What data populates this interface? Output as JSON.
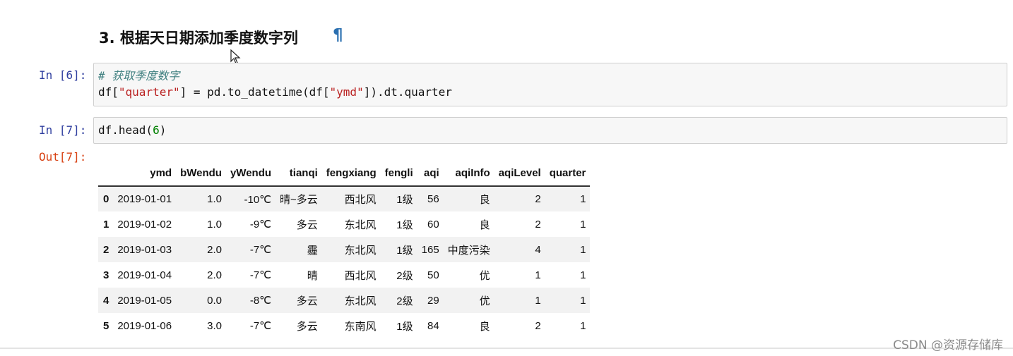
{
  "heading": "3. 根据天日期添加季度数字列",
  "pilcrow": "¶",
  "cells": {
    "in6": {
      "prompt": "In [6]:",
      "comment": "# 获取季度数字",
      "code_a": "df[",
      "code_s1": "\"quarter\"",
      "code_b": "] = pd.to_datetime(df[",
      "code_s2": "\"ymd\"",
      "code_c": "]).dt.quarter"
    },
    "in7": {
      "prompt": "In [7]:",
      "code_a": "df.head(",
      "code_num": "6",
      "code_b": ")"
    },
    "out7": {
      "prompt": "Out[7]:"
    }
  },
  "table": {
    "columns": [
      "",
      "ymd",
      "bWendu",
      "yWendu",
      "tianqi",
      "fengxiang",
      "fengli",
      "aqi",
      "aqiInfo",
      "aqiLevel",
      "quarter"
    ],
    "rows": [
      [
        "0",
        "2019-01-01",
        "1.0",
        "-10℃",
        "晴~多云",
        "西北风",
        "1级",
        "56",
        "良",
        "2",
        "1"
      ],
      [
        "1",
        "2019-01-02",
        "1.0",
        "-9℃",
        "多云",
        "东北风",
        "1级",
        "60",
        "良",
        "2",
        "1"
      ],
      [
        "2",
        "2019-01-03",
        "2.0",
        "-7℃",
        "霾",
        "东北风",
        "1级",
        "165",
        "中度污染",
        "4",
        "1"
      ],
      [
        "3",
        "2019-01-04",
        "2.0",
        "-7℃",
        "晴",
        "西北风",
        "2级",
        "50",
        "优",
        "1",
        "1"
      ],
      [
        "4",
        "2019-01-05",
        "0.0",
        "-8℃",
        "多云",
        "东北风",
        "2级",
        "29",
        "优",
        "1",
        "1"
      ],
      [
        "5",
        "2019-01-06",
        "3.0",
        "-7℃",
        "多云",
        "东南风",
        "1级",
        "84",
        "良",
        "2",
        "1"
      ]
    ]
  },
  "watermark": "CSDN @资源存储库"
}
